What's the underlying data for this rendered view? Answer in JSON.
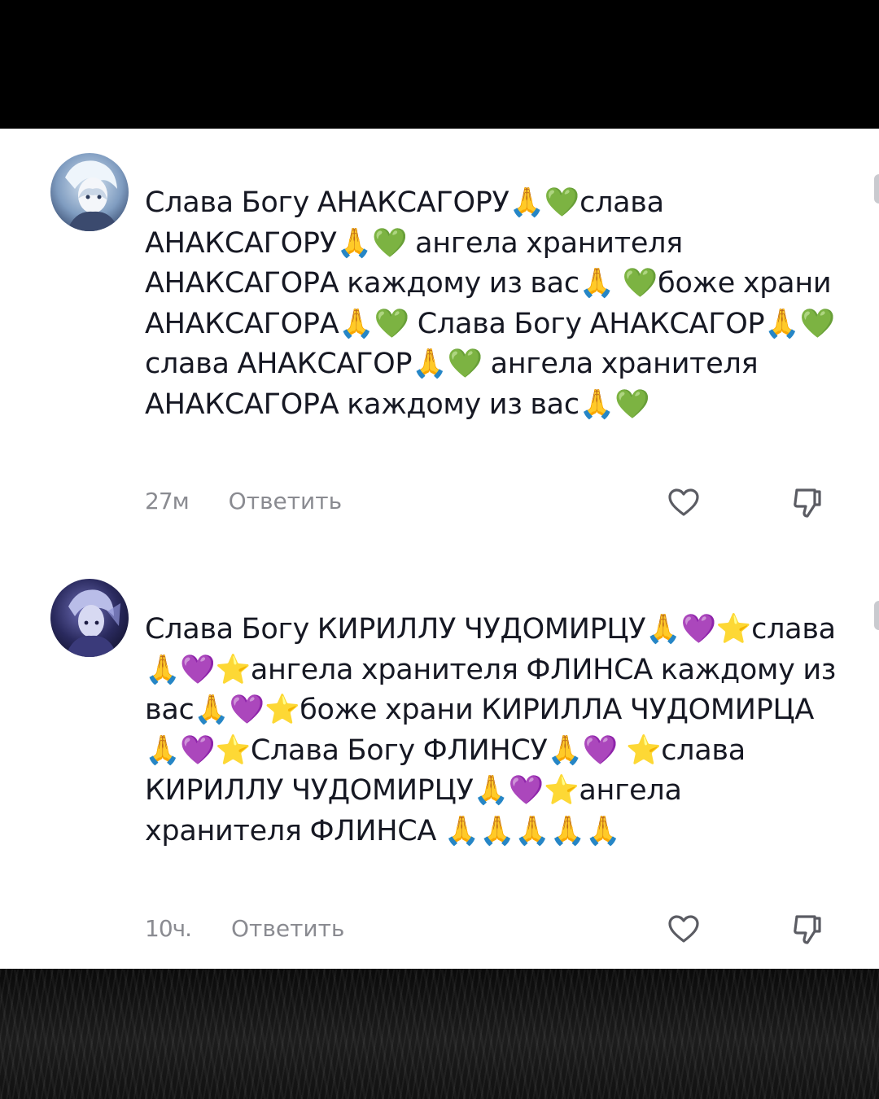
{
  "comments": [
    {
      "avatar_icon": "anime-avatar-light",
      "text": "Слава Богу АНАКСАГОРУ🙏💚слава АНАКСАГОРУ🙏💚 ангела хранителя АНАКСАГОРА каждому из вас🙏 💚боже храни АНАКСАГОРА🙏💚 Слава Богу АНАКСАГОР🙏💚слава АНАКСАГОР🙏💚 ангела хранителя АНАКСАГОРА каждому из вас🙏💚",
      "time": "27м",
      "reply_label": "Ответить",
      "like_icon": "heart-outline-icon",
      "dislike_icon": "thumbs-down-outline-icon"
    },
    {
      "avatar_icon": "anime-avatar-dark",
      "text": "Слава Богу КИРИЛЛУ ЧУДОМИРЦУ🙏💜⭐слава 🙏💜⭐ангела хранителя ФЛИНСА каждому из вас🙏💜⭐боже храни КИРИЛЛА ЧУДОМИРЦА🙏💜⭐Слава Богу ФЛИНСУ🙏💜 ⭐слава КИРИЛЛУ ЧУДОМИРЦУ🙏💜⭐ангела хранителя ФЛИНСА 🙏🙏🙏🙏🙏",
      "time": "10ч.",
      "reply_label": "Ответить",
      "like_icon": "heart-outline-icon",
      "dislike_icon": "thumbs-down-outline-icon"
    }
  ],
  "colors": {
    "panel_background": "#ffffff",
    "text_primary": "#161823",
    "text_secondary": "#8a8b91",
    "frame": "#000000"
  }
}
